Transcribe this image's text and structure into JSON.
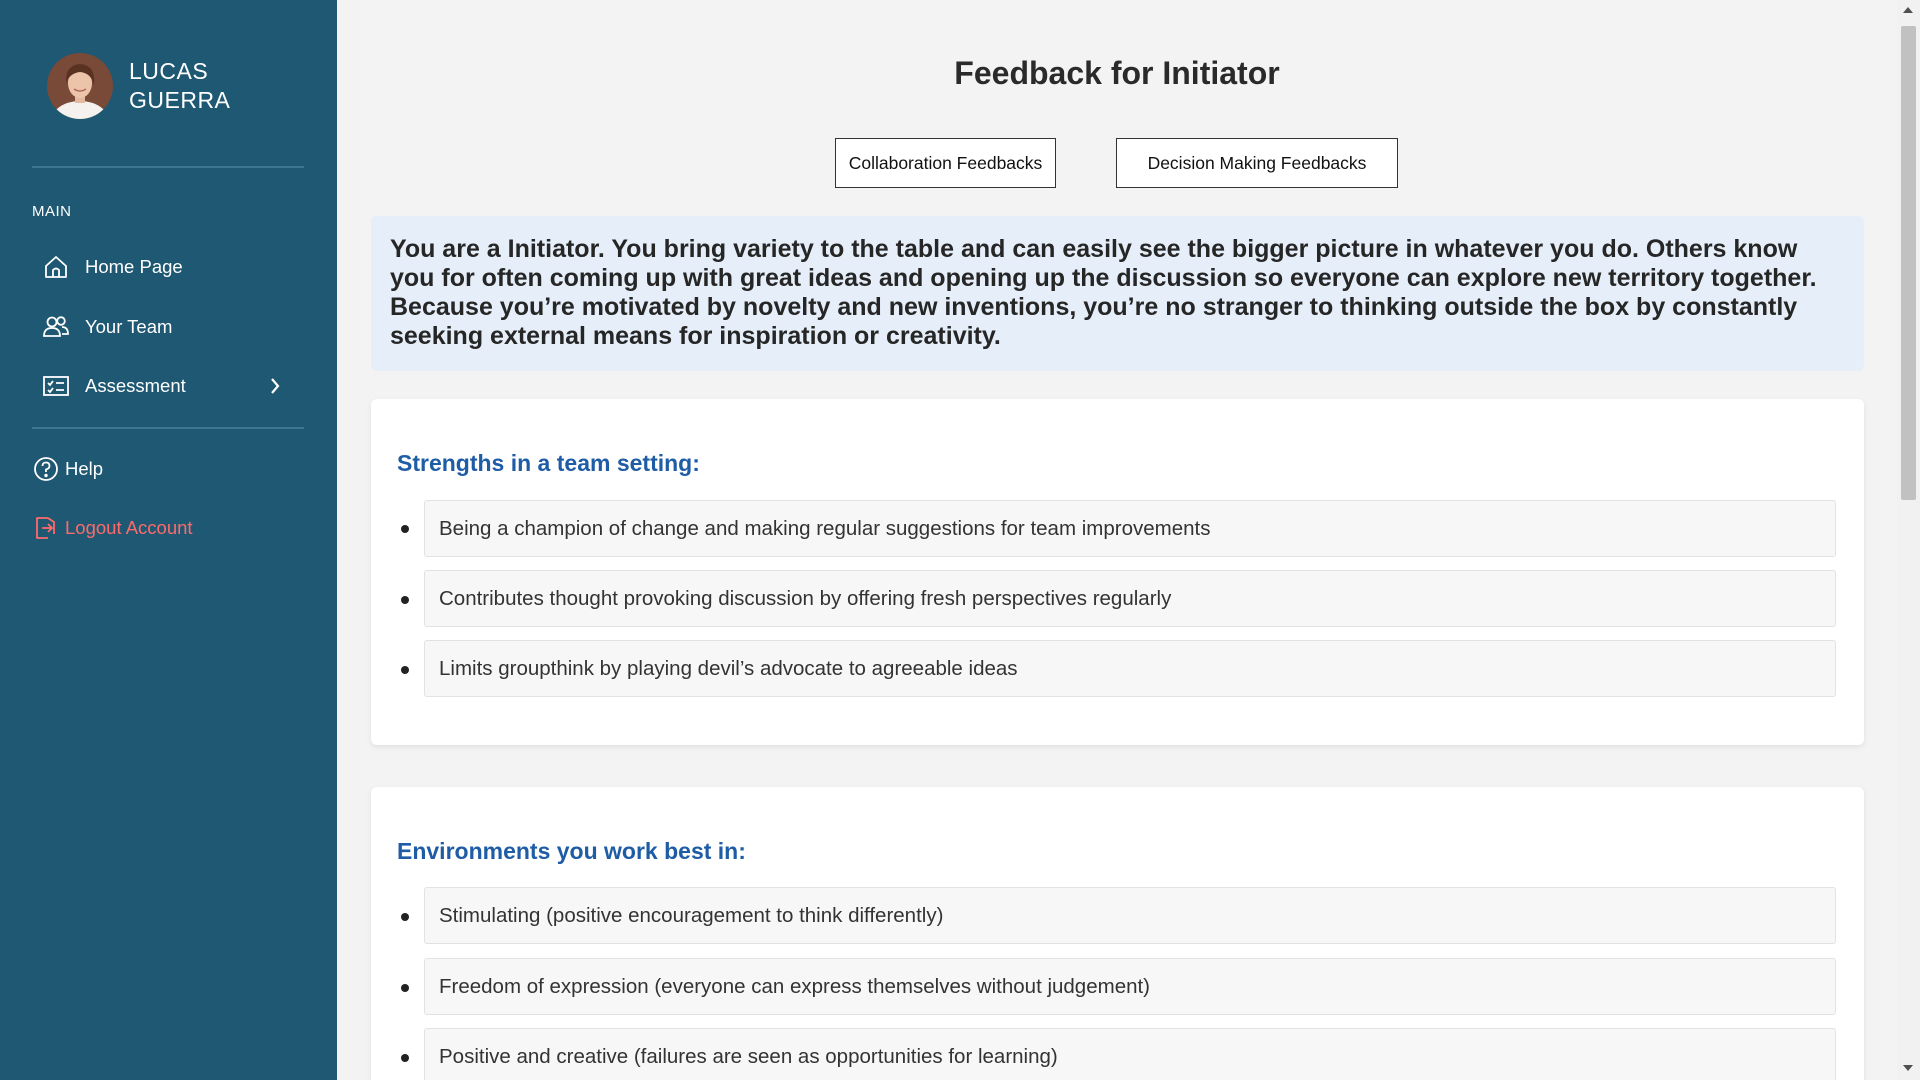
{
  "user": {
    "first_name": "LUCAS",
    "last_name": "GUERRA"
  },
  "sidebar": {
    "section_label": "MAIN",
    "items": [
      {
        "label": "Home Page",
        "icon": "home-icon"
      },
      {
        "label": "Your Team",
        "icon": "team-icon"
      },
      {
        "label": "Assessment",
        "icon": "assessment-icon"
      }
    ],
    "help_label": "Help",
    "logout_label": "Logout Account"
  },
  "main": {
    "title": "Feedback for Initiator",
    "tabs": [
      {
        "label": "Collaboration Feedbacks"
      },
      {
        "label": "Decision Making Feedbacks"
      }
    ],
    "summary": "You are a Initiator. You bring variety to the table and can easily see the bigger picture in whatever you do. Others know you for often coming up with great ideas and opening up the discussion so everyone can explore new territory together. Because you’re motivated by novelty and new inventions, you’re no stranger to thinking outside the box by constantly seeking external means for inspiration or creativity.",
    "sections": [
      {
        "title": "Strengths in a team setting:",
        "items": [
          "Being a champion of change and making regular suggestions for team improvements",
          "Contributes thought provoking discussion by offering fresh perspectives regularly",
          "Limits groupthink by playing devil’s advocate to agreeable ideas"
        ]
      },
      {
        "title": "Environments you work best in:",
        "items": [
          "Stimulating (positive encouragement to think differently)",
          "Freedom of expression (everyone can express themselves without judgement)",
          "Positive and creative (failures are seen as opportunities for learning)"
        ]
      }
    ]
  },
  "colors": {
    "sidebar_bg": "#1e5872",
    "accent_heading": "#1e5ca6",
    "logout": "#ff6a6a",
    "summary_bg": "#e6eff9"
  }
}
